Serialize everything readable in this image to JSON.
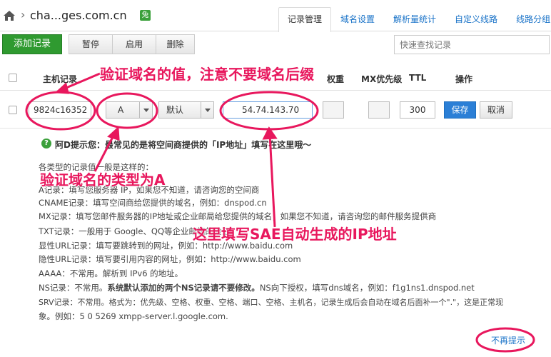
{
  "header": {
    "domain": "cha...ges.com.cn",
    "badge": "兔",
    "tabs": [
      {
        "label": "记录管理",
        "active": true
      },
      {
        "label": "域名设置",
        "active": false
      },
      {
        "label": "解析量统计",
        "active": false
      },
      {
        "label": "自定义线路",
        "active": false
      },
      {
        "label": "线路分组",
        "active": false
      }
    ]
  },
  "toolbar": {
    "add_label": "添加记录",
    "pause_label": "暂停",
    "enable_label": "启用",
    "delete_label": "删除",
    "search_placeholder": "快速查找记录"
  },
  "table": {
    "headers": {
      "host": "主机记录",
      "weight": "权重",
      "mx": "MX优先级",
      "ttl": "TTL",
      "ops": "操作"
    }
  },
  "edit_row": {
    "host_value": "9824c16352",
    "type_value": "A",
    "line_value": "默认",
    "record_value": "54.74.143.70",
    "ttl_value": "300",
    "save_label": "保存",
    "cancel_label": "取消"
  },
  "tips": {
    "title": "阿D提示您：最常见的是将空间商提供的「IP地址」填写在这里哦～",
    "lines": [
      "各类型的记录值一般是这样的：",
      "A记录：填写您服务器 IP，如果您不知道，请咨询您的空间商",
      "CNAME记录：填写空间商给您提供的域名，例如：dnspod.cn",
      "MX记录：填写您邮件服务器的IP地址或企业邮局给您提供的域名，如果您不知道，请咨询您的邮件服务提供商",
      "TXT记录：一般用于 Google、QQ等企业邮箱的验证",
      "显性URL记录：填写要跳转到的网址，例如：http://www.baidu.com",
      "隐性URL记录：填写要引用内容的网址，例如：http://www.baidu.com",
      "AAAA：不常用。解析到 IPv6 的地址。"
    ],
    "ns_prefix": "NS记录：不常用。",
    "ns_bold": "系统默认添加的两个NS记录请不要修改。",
    "ns_suffix": "NS向下授权，填写dns域名，例如：f1g1ns1.dnspod.net",
    "srv_line1": "SRV记录：不常用。格式为：优先级、空格、权重、空格、端口、空格、主机名，记录生成后会自动在域名后面补一个\".\"，这是正常现",
    "srv_line2": "象。例如：5 0 5269 xmpp-server.l.google.com.",
    "dismiss_label": "不再提示"
  },
  "annotations": {
    "host_note": "验证域名的值，注意不要域名后缀",
    "type_note": "验证域名的类型为A",
    "ip_note": "这里填写SAE自动生成的IP地址"
  },
  "colors": {
    "annotation": "#e8175d",
    "accent_green": "#2f9a30",
    "link_blue": "#1a73c8"
  }
}
